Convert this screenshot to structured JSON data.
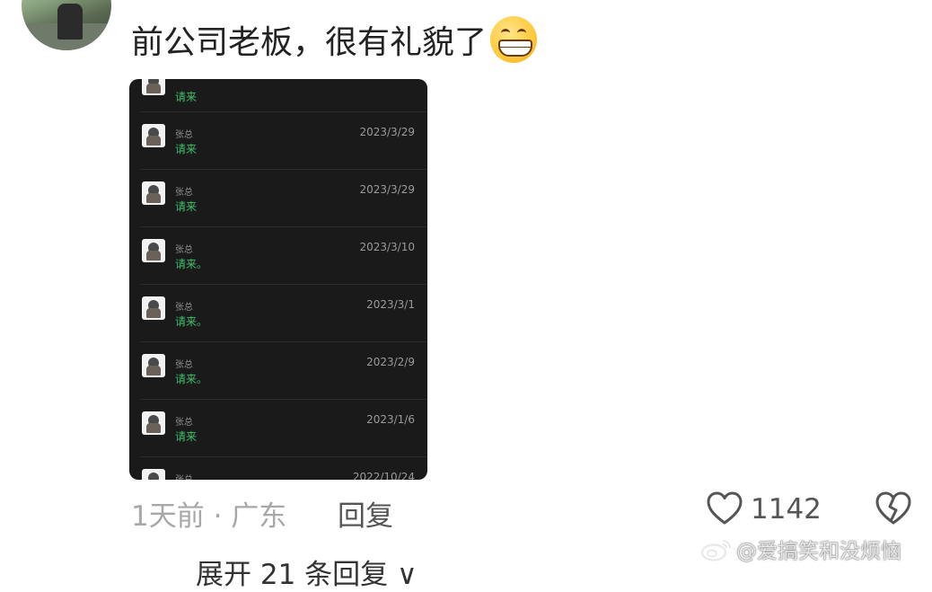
{
  "post": {
    "comment_text": "前公司老板，很有礼貌了",
    "emoji": "grinning-face-emoji"
  },
  "screenshot": {
    "messages": [
      {
        "name": "",
        "msg": "请来",
        "date": ""
      },
      {
        "name": "张总",
        "msg": "请来",
        "date": "2023/3/29"
      },
      {
        "name": "张总",
        "msg": "请来",
        "date": "2023/3/29"
      },
      {
        "name": "张总",
        "msg": "请来。",
        "date": "2023/3/10"
      },
      {
        "name": "张总",
        "msg": "请来。",
        "date": "2023/3/1"
      },
      {
        "name": "张总",
        "msg": "请来。",
        "date": "2023/2/9"
      },
      {
        "name": "张总",
        "msg": "请来",
        "date": "2023/1/6"
      },
      {
        "name": "张总",
        "msg": "",
        "date": "2022/10/24"
      }
    ]
  },
  "footer": {
    "time_location": "1天前 · 广东",
    "reply_label": "回复",
    "like_count": "1142",
    "expand_label": "展开 21 条回复 ∨"
  },
  "watermark": {
    "text": "@爱搞笑和没烦恼"
  },
  "icons": {
    "like": "heart-outline-icon",
    "dislike": "broken-heart-icon",
    "weibo": "weibo-logo"
  }
}
